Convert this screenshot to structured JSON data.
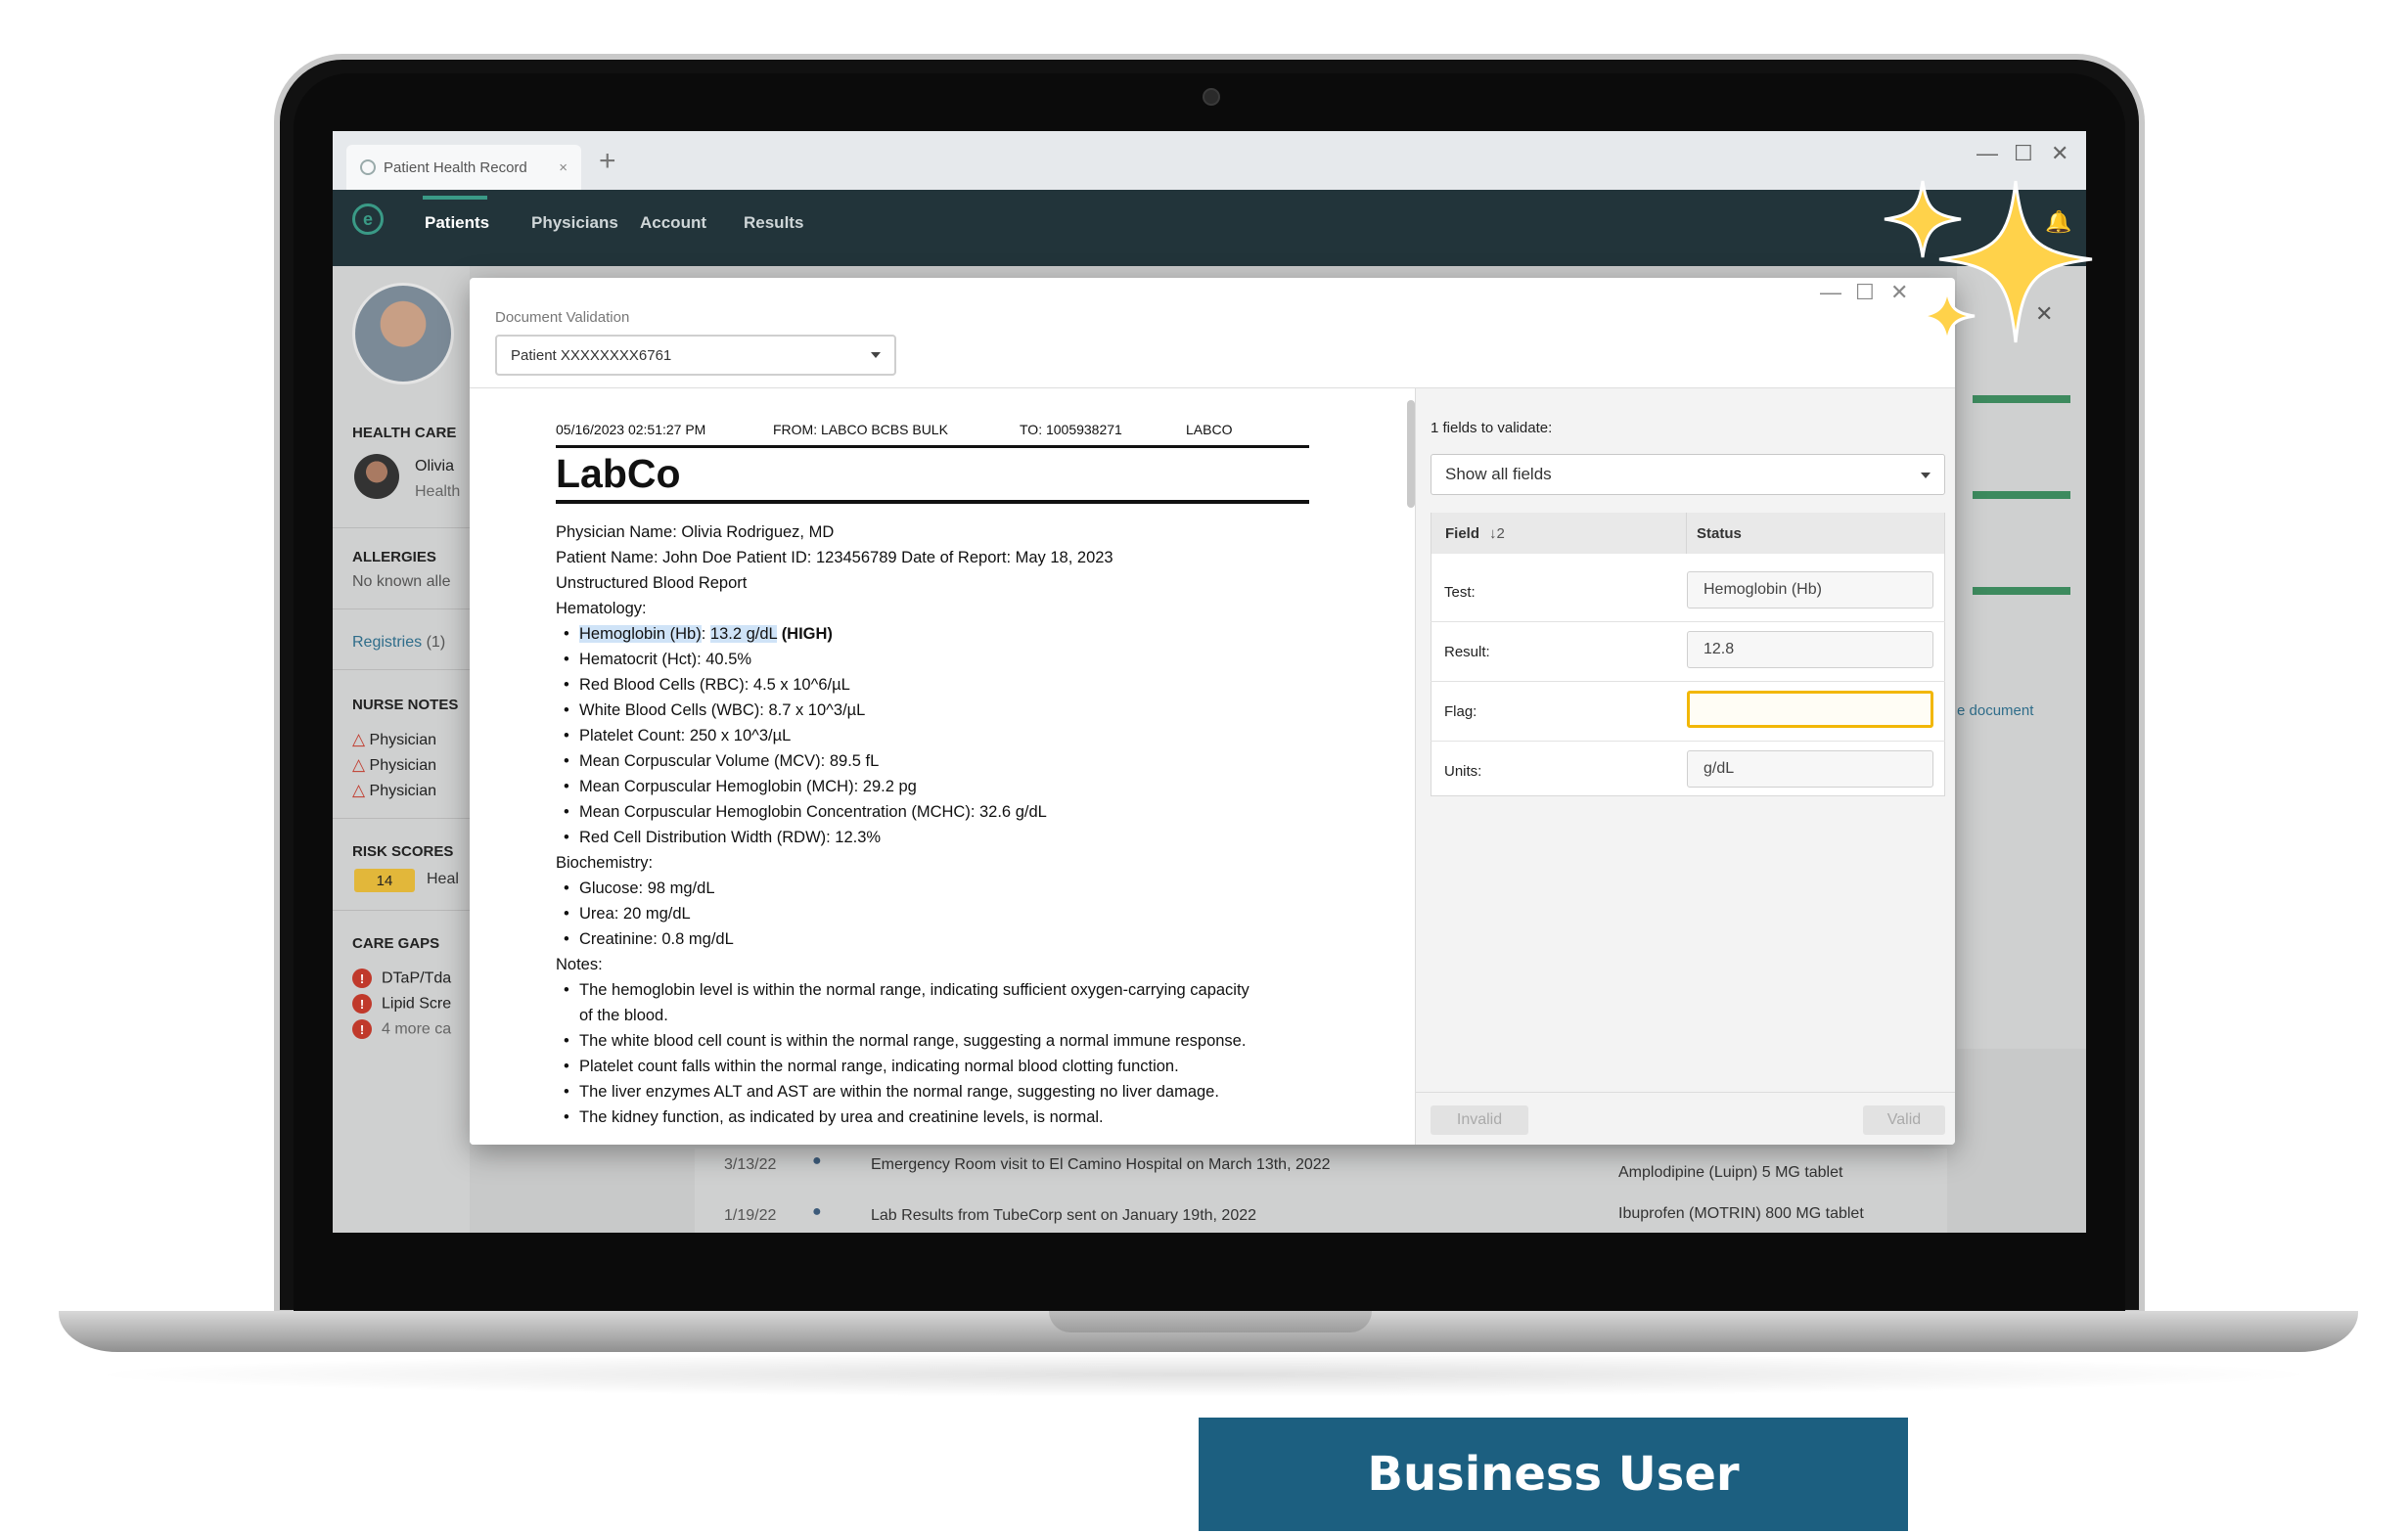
{
  "browser": {
    "tab_title": "Patient Health Record",
    "tab_close": "×",
    "new_tab": "+",
    "win_minimize": "—",
    "win_maximize": "☐",
    "win_close": "✕"
  },
  "nav": {
    "logo": "e",
    "items": [
      "Patients",
      "Physicians",
      "Account",
      "Results"
    ],
    "active": "Patients",
    "bell": "🔔"
  },
  "sidebar": {
    "health_care_heading": "HEALTH CARE",
    "care_person_name": "Olivia",
    "care_person_role": "Health",
    "allergies_heading": "ALLERGIES",
    "allergies_text": "No known alle",
    "registries_label": "Registries",
    "registries_count": "(1)",
    "nurse_notes_heading": "NURSE NOTES",
    "nurse_notes": [
      "Physician",
      "Physician",
      "Physician"
    ],
    "risk_heading": "RISK SCORES",
    "risk_value": "14",
    "risk_label": "Heal",
    "care_gaps_heading": "CARE GAPS",
    "care_gaps": [
      "DTaP/Tda",
      "Lipid Scre",
      "4 more ca"
    ]
  },
  "background": {
    "timeline": [
      {
        "date": "3/13/22",
        "text": "Emergency Room visit to El Camino Hospital on March 13th, 2022"
      },
      {
        "date": "1/19/22",
        "text": "Lab Results from TubeCorp sent on January 19th, 2022"
      }
    ],
    "meds": [
      "Amplodipine (Luipn) 5 MG tablet",
      "Ibuprofen (MOTRIN) 800 MG tablet"
    ],
    "right_link": "e document",
    "right_close": "✕"
  },
  "dialog": {
    "title": "Document Validation",
    "patient_select": "Patient XXXXXXXX6761",
    "win_minimize": "—",
    "win_maximize": "☐",
    "win_close": "✕",
    "doc": {
      "timestamp": "05/16/2023 02:51:27 PM",
      "from": "FROM: LABCO BCBS BULK",
      "to": "TO: 1005938271",
      "org": "LABCO",
      "brand": "LabCo",
      "physician": "Physician Name: Olivia Rodriguez, MD",
      "patient_line": "Patient Name: John Doe Patient ID: 123456789 Date of Report: May 18, 2023",
      "report_type": "Unstructured Blood Report",
      "hematology_heading": "Hematology:",
      "hb_label": "Hemoglobin (Hb)",
      "hb_value": "13.2 g/dL",
      "hb_flag": "(HIGH)",
      "hematology": [
        "Hematocrit (Hct): 40.5%",
        "Red Blood Cells (RBC): 4.5 x 10^6/µL",
        "White Blood Cells (WBC): 8.7 x 10^3/µL",
        "Platelet Count: 250 x 10^3/µL",
        "Mean Corpuscular Volume (MCV): 89.5 fL",
        "Mean Corpuscular Hemoglobin (MCH): 29.2 pg",
        "Mean Corpuscular Hemoglobin Concentration (MCHC): 32.6 g/dL",
        "Red Cell Distribution Width (RDW): 12.3%"
      ],
      "biochem_heading": "Biochemistry:",
      "biochem": [
        "Glucose: 98 mg/dL",
        "Urea: 20 mg/dL",
        "Creatinine: 0.8 mg/dL"
      ],
      "notes_heading": "Notes:",
      "note1_line1": "The hemoglobin level is within the normal range, indicating sufficient oxygen-carrying capacity",
      "note1_line2": "of the blood.",
      "notes": [
        "The white blood cell count is within the normal range, suggesting a normal immune response.",
        "Platelet count falls within the normal range, indicating normal blood clotting function.",
        "The liver enzymes ALT and AST are within the normal range, suggesting no liver damage.",
        "The kidney function, as indicated by urea and creatinine levels, is normal."
      ]
    },
    "validation": {
      "count_label": "1 fields to validate:",
      "filter_select": "Show all fields",
      "col_field": "Field",
      "sort_icon": "↓2",
      "col_status": "Status",
      "rows": [
        {
          "label": "Test:",
          "value": "Hemoglobin (Hb)"
        },
        {
          "label": "Result:",
          "value": "12.8"
        },
        {
          "label": "Flag:",
          "value": ""
        },
        {
          "label": "Units:",
          "value": "g/dL"
        }
      ],
      "invalid_button": "Invalid",
      "valid_button": "Valid"
    }
  },
  "badge": "Business User",
  "colors": {
    "nav_bg": "#22343a",
    "accent": "#3a9a86",
    "flag_highlight": "#f2b705",
    "badge_bg": "#1c5f80",
    "sparkle": "#ffd24a"
  }
}
